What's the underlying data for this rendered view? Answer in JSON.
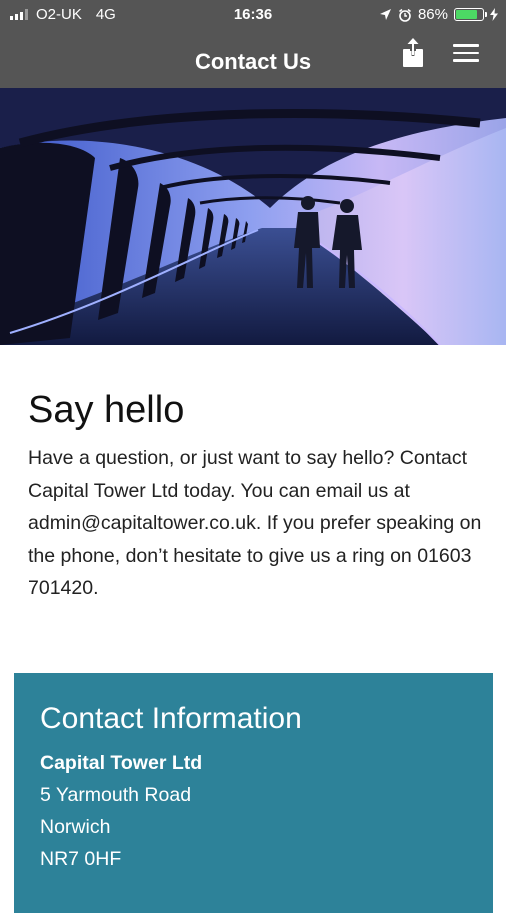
{
  "status_bar": {
    "carrier": "O2-UK",
    "network": "4G",
    "time": "16:36",
    "battery": "86%",
    "battery_level": 0.86,
    "battery_color": "#4cd964",
    "icons": [
      "signal-icon",
      "location-arrow-icon",
      "alarm-icon",
      "battery-icon",
      "charging-bolt-icon"
    ]
  },
  "nav": {
    "title": "Contact Us",
    "share_icon": "share-icon",
    "menu_icon": "hamburger-menu-icon",
    "background": "#555555"
  },
  "hero": {
    "description_icon": "hero-image"
  },
  "intro": {
    "heading": "Say hello",
    "body": "Have a question, or just want to say hello? Contact Capital Tower Ltd today. You can email us at admin@capitaltower.co.uk. If you prefer speaking on the phone, don’t hesitate to give us a ring on 01603 701420."
  },
  "contact_info": {
    "heading": "Contact Information",
    "company": "Capital Tower Ltd",
    "address_line1": "5 Yarmouth Road",
    "city": "Norwich",
    "postcode": "NR7 0HF",
    "background": "#2d8299"
  }
}
